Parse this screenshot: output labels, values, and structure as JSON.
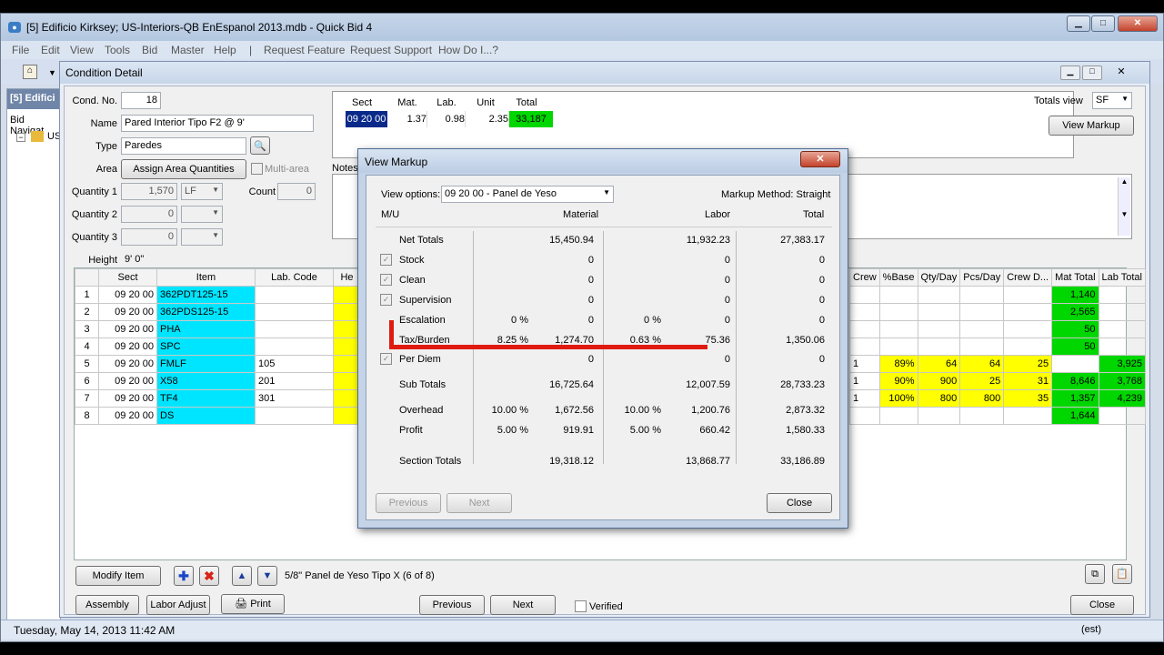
{
  "window": {
    "title": "[5] Edificio Kirksey; US-Interiors-QB EnEspanol 2013.mdb - Quick Bid 4"
  },
  "menu": [
    "File",
    "Edit",
    "View",
    "Tools",
    "Bid",
    "Master",
    "Help",
    "|",
    "Request Feature",
    "Request Support",
    "How Do I...?"
  ],
  "leftpane": {
    "header": "[5] Edifici",
    "nav": "Bid Navigat",
    "tree": "US"
  },
  "status": {
    "datetime": "Tuesday, May 14, 2013 11:42 AM",
    "mode": "(est)"
  },
  "condition": {
    "caption": "Condition Detail",
    "cond_no_label": "Cond. No.",
    "cond_no": "18",
    "name_label": "Name",
    "name": "Pared Interior Tipo F2 @ 9'",
    "type_label": "Type",
    "type": "Paredes",
    "area_label": "Area",
    "assign_area": "Assign Area Quantities",
    "multi_area": "Multi-area",
    "q1_label": "Quantity 1",
    "q1": "1,570",
    "q1_unit": "LF",
    "count_label": "Count",
    "count": "0",
    "q2_label": "Quantity 2",
    "q2": "0",
    "q3_label": "Quantity 3",
    "q3": "0",
    "height_label": "Height",
    "height": "9' 0\"",
    "notes_label": "Notes",
    "totals_view_label": "Totals view",
    "totals_view": "SF",
    "view_markup_btn": "View Markup",
    "summary": {
      "headers": [
        "Sect",
        "Mat.",
        "Lab.",
        "Unit",
        "Total"
      ],
      "row": [
        "09 20 00",
        "1.37",
        "0.98",
        "2.35",
        "33,187"
      ]
    },
    "grid_headers": [
      "",
      "Sect",
      "Item",
      "Lab. Code",
      "He"
    ],
    "rows": [
      {
        "n": "1",
        "sect": "09 20 00",
        "item": "362PDT125-15",
        "lab": ""
      },
      {
        "n": "2",
        "sect": "09 20 00",
        "item": "362PDS125-15",
        "lab": ""
      },
      {
        "n": "3",
        "sect": "09 20 00",
        "item": "PHA",
        "lab": ""
      },
      {
        "n": "4",
        "sect": "09 20 00",
        "item": "SPC",
        "lab": ""
      },
      {
        "n": "5",
        "sect": "09 20 00",
        "item": "FMLF",
        "lab": "105"
      },
      {
        "n": "6",
        "sect": "09 20 00",
        "item": "X58",
        "lab": "201"
      },
      {
        "n": "7",
        "sect": "09 20 00",
        "item": "TF4",
        "lab": "301"
      },
      {
        "n": "8",
        "sect": "09 20 00",
        "item": "DS",
        "lab": ""
      }
    ],
    "right_headers": [
      "Crew",
      "%Base",
      "Qty/Day",
      "Pcs/Day",
      "Crew D...",
      "Mat Total",
      "Lab Total"
    ],
    "right_rows": [
      [
        "",
        "",
        "",
        "",
        "",
        "1,140",
        ""
      ],
      [
        "",
        "",
        "",
        "",
        "",
        "2,565",
        ""
      ],
      [
        "",
        "",
        "",
        "",
        "",
        "50",
        ""
      ],
      [
        "",
        "",
        "",
        "",
        "",
        "50",
        ""
      ],
      [
        "1",
        "89%",
        "64",
        "64",
        "25",
        "",
        "3,925"
      ],
      [
        "1",
        "90%",
        "900",
        "25",
        "31",
        "8,646",
        "3,768"
      ],
      [
        "1",
        "100%",
        "800",
        "800",
        "35",
        "1,357",
        "4,239"
      ],
      [
        "",
        "",
        "",
        "",
        "",
        "1,644",
        ""
      ]
    ],
    "modify_item": "Modify Item",
    "item_desc": "5/8\" Panel de Yeso Tipo X (6 of 8)",
    "assembly": "Assembly",
    "labor_adjust": "Labor Adjust",
    "print": "Print",
    "previous": "Previous",
    "next": "Next",
    "verified": "Verified",
    "close": "Close"
  },
  "markup": {
    "caption": "View Markup",
    "view_options_label": "View options:",
    "view_option": "09 20 00 - Panel de Yeso",
    "method": "Markup Method: Straight",
    "col_mu": "M/U",
    "col_material": "Material",
    "col_labor": "Labor",
    "col_total": "Total",
    "rows": [
      {
        "label": "Net Totals",
        "mp": "",
        "mat": "15,450.94",
        "lp": "",
        "lab": "11,932.23",
        "tot": "27,383.17",
        "chk": false
      },
      {
        "label": "Stock",
        "mp": "",
        "mat": "0",
        "lp": "",
        "lab": "0",
        "tot": "0",
        "chk": true
      },
      {
        "label": "Clean",
        "mp": "",
        "mat": "0",
        "lp": "",
        "lab": "0",
        "tot": "0",
        "chk": true
      },
      {
        "label": "Supervision",
        "mp": "",
        "mat": "0",
        "lp": "",
        "lab": "0",
        "tot": "0",
        "chk": true
      },
      {
        "label": "Escalation",
        "mp": "0 %",
        "mat": "0",
        "lp": "0 %",
        "lab": "0",
        "tot": "0",
        "chk": false
      },
      {
        "label": "Tax/Burden",
        "mp": "8.25 %",
        "mat": "1,274.70",
        "lp": "0.63 %",
        "lab": "75.36",
        "tot": "1,350.06",
        "chk": false
      },
      {
        "label": "Per Diem",
        "mp": "",
        "mat": "0",
        "lp": "",
        "lab": "0",
        "tot": "0",
        "chk": true
      },
      {
        "label": "Sub Totals",
        "mp": "",
        "mat": "16,725.64",
        "lp": "",
        "lab": "12,007.59",
        "tot": "28,733.23",
        "chk": false
      },
      {
        "label": "Overhead",
        "mp": "10.00 %",
        "mat": "1,672.56",
        "lp": "10.00 %",
        "lab": "1,200.76",
        "tot": "2,873.32",
        "chk": false
      },
      {
        "label": "Profit",
        "mp": "5.00 %",
        "mat": "919.91",
        "lp": "5.00 %",
        "lab": "660.42",
        "tot": "1,580.33",
        "chk": false
      },
      {
        "label": "Section Totals",
        "mp": "",
        "mat": "19,318.12",
        "lp": "",
        "lab": "13,868.77",
        "tot": "33,186.89",
        "chk": false
      }
    ],
    "previous": "Previous",
    "next": "Next",
    "close": "Close"
  }
}
